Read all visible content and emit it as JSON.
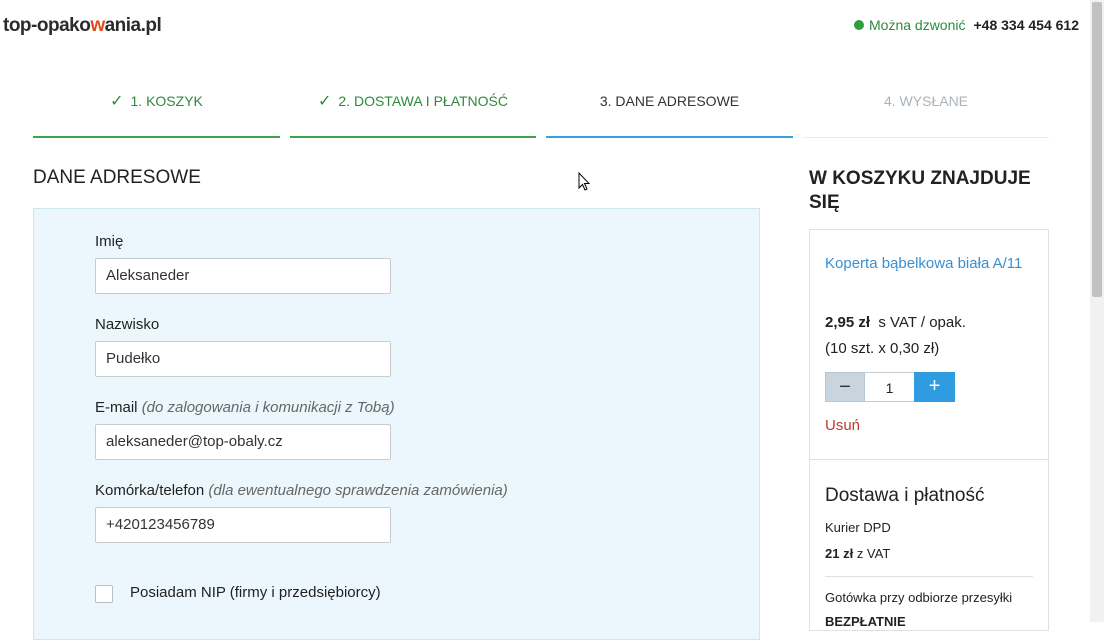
{
  "header": {
    "logo_pre": "top-opako",
    "logo_w": "w",
    "logo_post": "ania.pl",
    "status_label": "Można dzwonić",
    "phone": "+48 334 454 612"
  },
  "steps": [
    {
      "label": "1. KOSZYK",
      "state": "done"
    },
    {
      "label": "2. DOSTAWA I PŁATNOŚĆ",
      "state": "done"
    },
    {
      "label": "3. DANE ADRESOWE",
      "state": "active"
    },
    {
      "label": "4. WYSŁANE",
      "state": "inactive"
    }
  ],
  "form": {
    "title": "DANE ADRESOWE",
    "first_name": {
      "label": "Imię",
      "value": "Aleksaneder"
    },
    "last_name": {
      "label": "Nazwisko",
      "value": "Pudełko"
    },
    "email": {
      "label": "E-mail",
      "hint": "(do zalogowania i komunikacji z Tobą)",
      "value": "aleksaneder@top-obaly.cz"
    },
    "phone": {
      "label": "Komórka/telefon",
      "hint": "(dla ewentualnego sprawdzenia zamówienia)",
      "value": "+420123456789"
    },
    "nip_checkbox": {
      "label": "Posiadam NIP (firmy i przedsiębiorcy)",
      "checked": false
    }
  },
  "cart": {
    "title": "W KOSZYKU ZNAJDUJE SIĘ",
    "product": {
      "name": "Koperta bąbelkowa biała A/11",
      "price": "2,95 zł",
      "price_suffix": "s VAT / opak.",
      "unit_info": "(10 szt. x 0,30 zł)",
      "quantity": "1",
      "remove_label": "Usuń"
    },
    "shipping": {
      "title": "Dostawa i płatność",
      "courier": "Kurier DPD",
      "price": "21 zł",
      "price_suffix": "z VAT",
      "payment": "Gotówka przy odbiorze przesyłki",
      "payment_price": "BEZPŁATNIE"
    }
  },
  "colors": {
    "done": "#3fa34d",
    "active": "#3a9ee0",
    "panel_bg": "#ebf7fc",
    "link": "#3a8fd0",
    "remove": "#c0392b"
  }
}
